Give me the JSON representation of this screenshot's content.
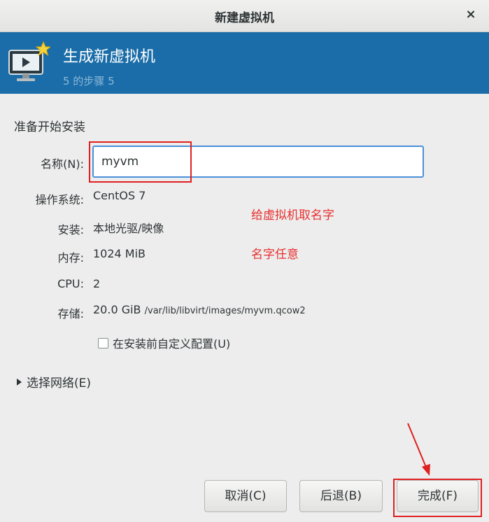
{
  "window": {
    "title": "新建虚拟机",
    "close_glyph": "×"
  },
  "banner": {
    "heading": "生成新虚拟机",
    "step": "5 的步骤 5",
    "icon": "vm-monitor-icon"
  },
  "section_title": "准备开始安装",
  "form": {
    "name_label": "名称(N):",
    "name_value": "myvm",
    "os_label": "操作系统:",
    "os_value": "CentOS 7",
    "install_label": "安装:",
    "install_value": "本地光驱/映像",
    "memory_label": "内存:",
    "memory_value": "1024 MiB",
    "cpu_label": "CPU:",
    "cpu_value": "2",
    "storage_label": "存储:",
    "storage_size": "20.0 GiB",
    "storage_path": "/var/lib/libvirt/images/myvm.qcow2",
    "customize_label": "在安装前自定义配置(U)",
    "customize_checked": false
  },
  "network_expander": "选择网络(E)",
  "annotations": {
    "name_note": "给虚拟机取名字",
    "name_note2": "名字任意"
  },
  "buttons": {
    "cancel": "取消(C)",
    "back": "后退(B)",
    "finish": "完成(F)"
  },
  "colors": {
    "banner": "#1a6da8",
    "annotation": "#e83030",
    "focus": "#4a90d9"
  }
}
